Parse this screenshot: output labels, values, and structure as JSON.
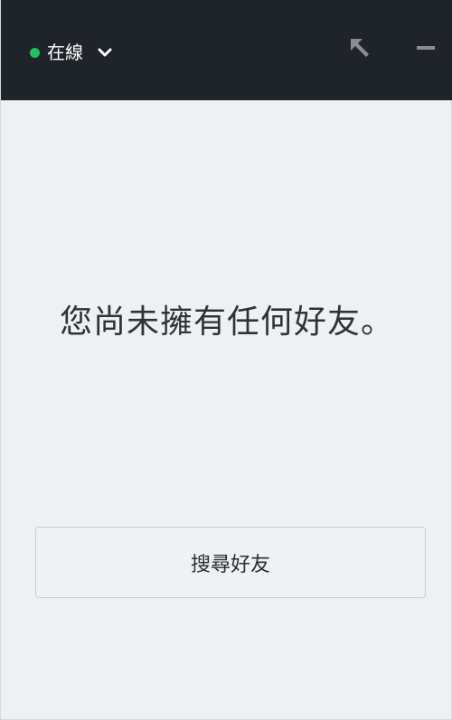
{
  "titlebar": {
    "status_label": "在線",
    "status_color": "#21c25e",
    "status_menu_icon": "chevron-down-icon",
    "popout_icon": "arrow-up-left-icon",
    "minimize_icon": "minimize-icon"
  },
  "main": {
    "empty_message": "您尚未擁有任何好友。",
    "search_button_label": "搜尋好友"
  }
}
